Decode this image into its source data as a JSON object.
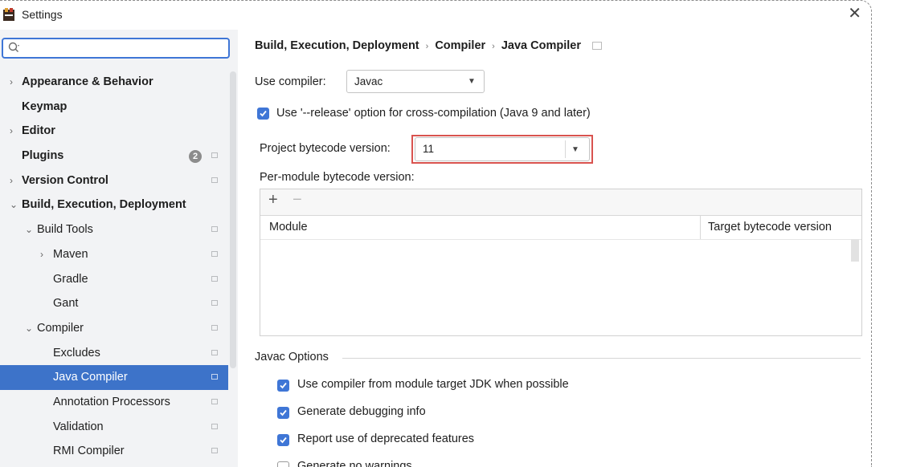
{
  "window": {
    "title": "Settings",
    "close_label": "✕"
  },
  "search": {
    "value": "",
    "placeholder": ""
  },
  "tree": [
    {
      "label": "Appearance & Behavior",
      "arrow": "›",
      "indent": 0,
      "bold": true
    },
    {
      "label": "Keymap",
      "arrow": "",
      "indent": 0,
      "bold": true
    },
    {
      "label": "Editor",
      "arrow": "›",
      "indent": 0,
      "bold": true
    },
    {
      "label": "Plugins",
      "arrow": "",
      "indent": 0,
      "bold": true,
      "badge": "2",
      "icon": true
    },
    {
      "label": "Version Control",
      "arrow": "›",
      "indent": 0,
      "bold": true,
      "icon": true
    },
    {
      "label": "Build, Execution, Deployment",
      "arrow": "⌄",
      "indent": 0,
      "bold": true
    },
    {
      "label": "Build Tools",
      "arrow": "⌄",
      "indent": 1,
      "icon": true
    },
    {
      "label": "Maven",
      "arrow": "›",
      "indent": 2,
      "icon": true
    },
    {
      "label": "Gradle",
      "arrow": "",
      "indent": 2,
      "icon": true
    },
    {
      "label": "Gant",
      "arrow": "",
      "indent": 2,
      "icon": true
    },
    {
      "label": "Compiler",
      "arrow": "⌄",
      "indent": 1,
      "icon": true
    },
    {
      "label": "Excludes",
      "arrow": "",
      "indent": 2,
      "icon": true
    },
    {
      "label": "Java Compiler",
      "arrow": "",
      "indent": 2,
      "icon": true,
      "selected": true
    },
    {
      "label": "Annotation Processors",
      "arrow": "",
      "indent": 2,
      "icon": true
    },
    {
      "label": "Validation",
      "arrow": "",
      "indent": 2,
      "icon": true
    },
    {
      "label": "RMI Compiler",
      "arrow": "",
      "indent": 2,
      "icon": true
    }
  ],
  "breadcrumb": {
    "part1": "Build, Execution, Deployment",
    "part2": "Compiler",
    "part3": "Java Compiler",
    "sep": "›"
  },
  "compiler": {
    "label": "Use compiler:",
    "value": "Javac",
    "release_option": "Use '--release' option for cross-compilation (Java 9 and later)",
    "release_checked": true,
    "bytecode_label": "Project bytecode version:",
    "bytecode_value": "11",
    "per_module_label": "Per-module bytecode version:"
  },
  "table": {
    "add": "+",
    "remove": "−",
    "col_module": "Module",
    "col_target": "Target bytecode version"
  },
  "javac": {
    "section_title": "Javac Options",
    "options": [
      {
        "label": "Use compiler from module target JDK when possible",
        "checked": true
      },
      {
        "label": "Generate debugging info",
        "checked": true
      },
      {
        "label": "Report use of deprecated features",
        "checked": true
      },
      {
        "label": "Generate no warnings",
        "checked": false
      }
    ]
  },
  "colors": {
    "accent": "#3f76d6",
    "selection": "#3d73c9",
    "highlight": "#d9534f"
  },
  "icons": {
    "dropdown": "▼",
    "settings": "settings-page-icon",
    "search": "search-icon",
    "app": "app-icon"
  }
}
